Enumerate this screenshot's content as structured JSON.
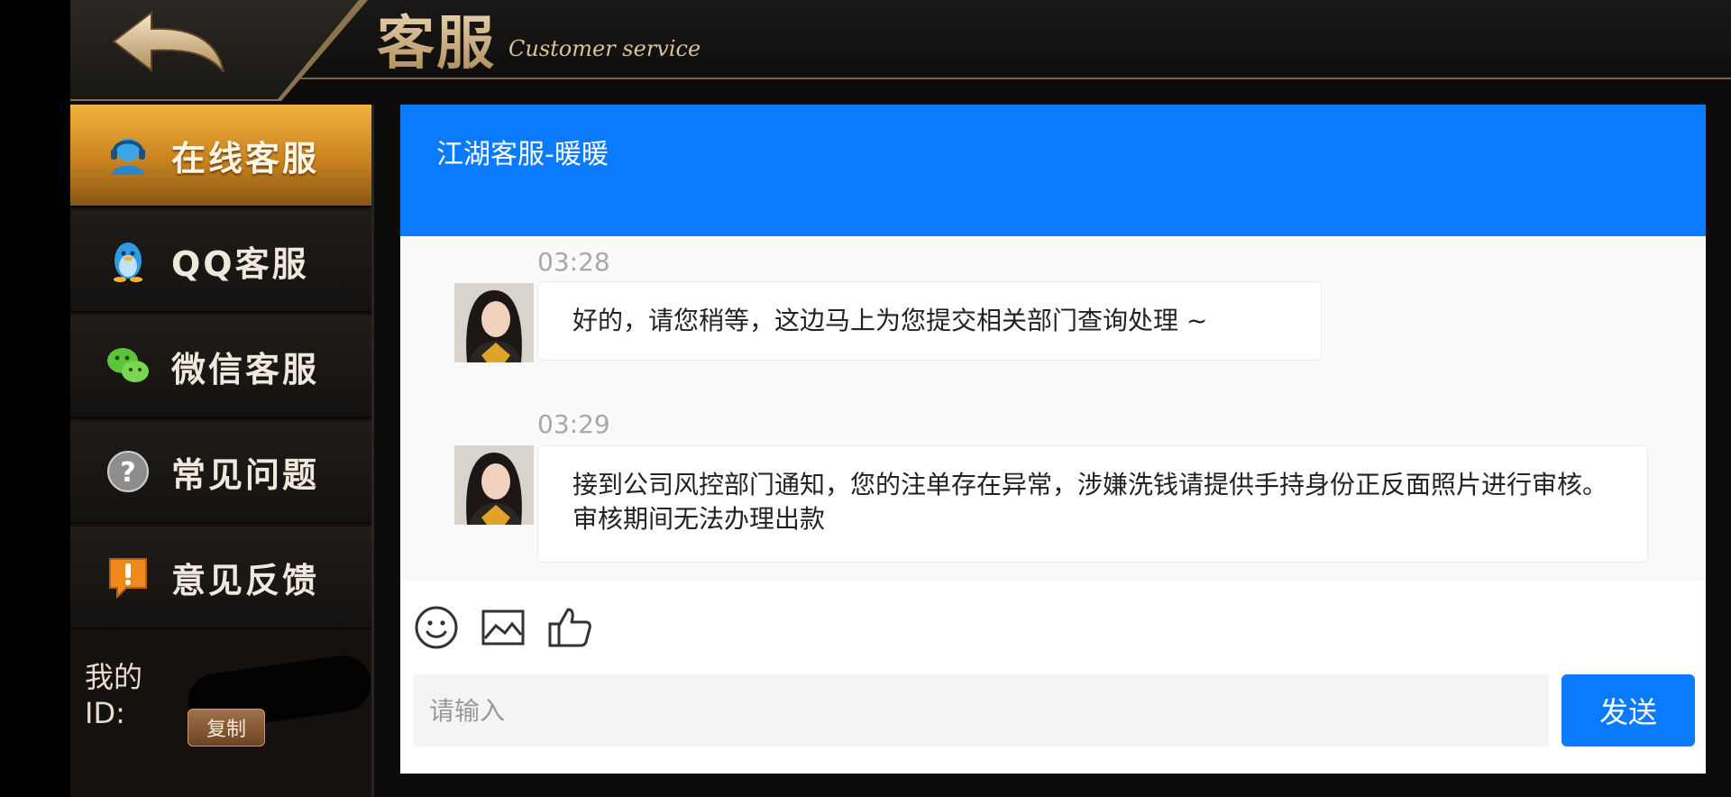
{
  "header": {
    "title_cn": "客服",
    "title_en": "Customer service"
  },
  "sidebar": {
    "items": [
      {
        "label": "在线客服",
        "icon": "headset-icon",
        "active": true
      },
      {
        "label": "QQ客服",
        "icon": "qq-penguin-icon",
        "active": false
      },
      {
        "label": "微信客服",
        "icon": "wechat-icon",
        "active": false
      },
      {
        "label": "常见问题",
        "icon": "question-icon",
        "active": false
      },
      {
        "label": "意见反馈",
        "icon": "feedback-icon",
        "active": false
      }
    ],
    "my_id_label": "我的ID:",
    "copy_label": "复制"
  },
  "chat": {
    "title": "江湖客服-暖暖",
    "messages": [
      {
        "time": "03:28",
        "text": "好的，请您稍等，这边马上为您提交相关部门查询处理 ~"
      },
      {
        "time": "03:29",
        "text": "接到公司风控部门通知，您的注单存在异常，涉嫌洗钱请提供手持身份正反面照片进行审核。审核期间无法办理出款"
      }
    ],
    "tools": [
      "emoji-icon",
      "image-icon",
      "thumbs-up-icon"
    ],
    "input_placeholder": "请输入",
    "send_label": "发送"
  },
  "colors": {
    "accent_blue": "#0a7bff",
    "active_gold": "#e8a433",
    "header_dark": "#161412"
  }
}
